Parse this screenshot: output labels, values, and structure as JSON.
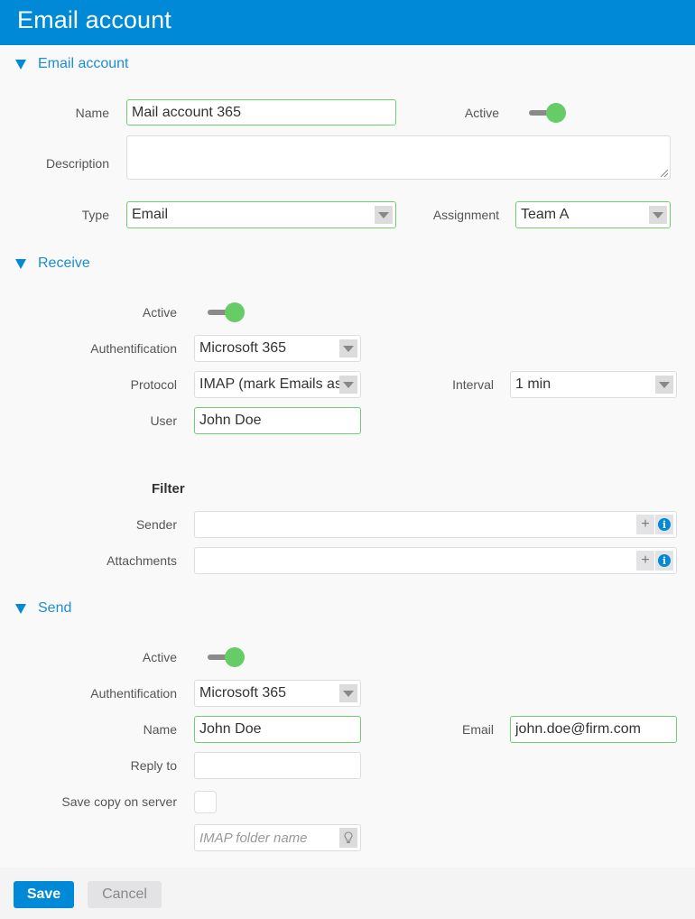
{
  "header": {
    "title": "Email account"
  },
  "colors": {
    "brand": "#0089d6",
    "toggle_on": "#66cc66",
    "valid_border": "#6fcf6f"
  },
  "sections": {
    "account": {
      "title": "Email account",
      "name_label": "Name",
      "name_value": "Mail account 365",
      "active_label": "Active",
      "active": true,
      "description_label": "Description",
      "description_value": "",
      "type_label": "Type",
      "type_value": "Email",
      "assignment_label": "Assignment",
      "assignment_value": "Team A"
    },
    "receive": {
      "title": "Receive",
      "active_label": "Active",
      "active": true,
      "auth_label": "Authentification",
      "auth_value": "Microsoft 365",
      "protocol_label": "Protocol",
      "protocol_value": "IMAP (mark Emails as read)",
      "interval_label": "Interval",
      "interval_value": "1 min",
      "user_label": "User",
      "user_value": "John Doe",
      "filter": {
        "title": "Filter",
        "sender_label": "Sender",
        "sender_value": "",
        "attachments_label": "Attachments",
        "attachments_value": "",
        "add_icon": "+",
        "info_icon": "i"
      }
    },
    "send": {
      "title": "Send",
      "active_label": "Active",
      "active": true,
      "auth_label": "Authentification",
      "auth_value": "Microsoft 365",
      "name_label": "Name",
      "name_value": "John Doe",
      "email_label": "Email",
      "email_value": "john.doe@firm.com",
      "reply_label": "Reply to",
      "reply_value": "",
      "save_copy_label": "Save copy on server",
      "save_copy_checked": false,
      "imap_folder_placeholder": "IMAP folder name"
    }
  },
  "footer": {
    "save_label": "Save",
    "cancel_label": "Cancel"
  }
}
